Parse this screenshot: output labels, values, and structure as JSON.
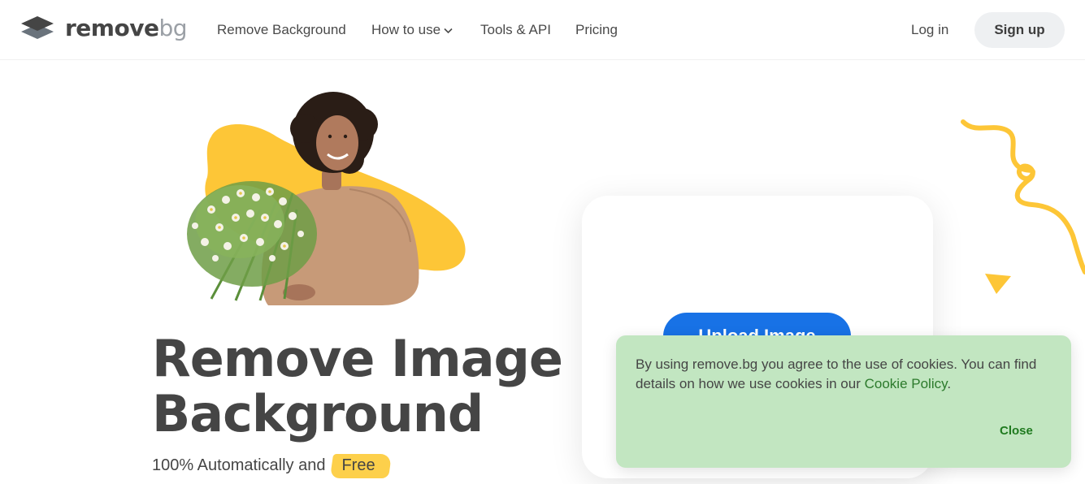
{
  "brand": {
    "name_main": "remove",
    "name_suffix": "bg"
  },
  "nav": {
    "items": [
      {
        "label": "Remove Background"
      },
      {
        "label": "How to use"
      },
      {
        "label": "Tools & API"
      },
      {
        "label": "Pricing"
      }
    ],
    "login": "Log in",
    "signup": "Sign up"
  },
  "hero": {
    "title_line1": "Remove Image",
    "title_line2": "Background",
    "subtitle": "100% Automatically and",
    "highlight": "Free",
    "upload_button": "Upload Image"
  },
  "cookie": {
    "text": "By using remove.bg you agree to the use of cookies. You can find details on how we use cookies in our ",
    "link": "Cookie Policy",
    "suffix": ".",
    "close": "Close"
  },
  "colors": {
    "accent_blue": "#1872e6",
    "accent_yellow": "#fdc637",
    "cookie_bg": "#c2e6c1",
    "cookie_link": "#2c7a2c",
    "text_dark": "#454545"
  }
}
